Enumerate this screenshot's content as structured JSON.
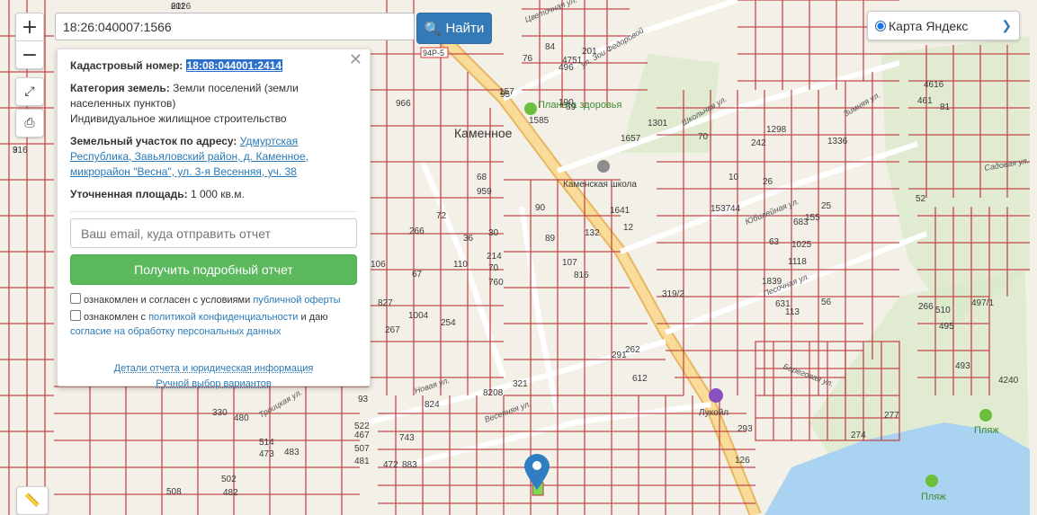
{
  "search": {
    "value": "18:26:040007:1566",
    "button_label": "Найти"
  },
  "controls": {
    "zoom_in": "+",
    "zoom_out": "−"
  },
  "layer": {
    "selected": "Карта Яндекс"
  },
  "popup": {
    "cadastral_label": "Кадастровый номер:",
    "cadastral_value": "18:08:044001:2414",
    "category_label": "Категория земель:",
    "category_value": "Земли поселений (земли населенных пунктов)",
    "category_use": "Индивидуальное жилищное строительство",
    "address_label": "Земельный участок по адресу:",
    "address_value": "Удмуртская Республика, Завьяловский район, д. Каменное, микрорайон \"Весна\", ул. 3-я Весенняя, уч. 38",
    "area_label": "Уточненная площадь:",
    "area_value": "1 000 кв.м.",
    "email_placeholder": "Ваш email, куда отправить отчет",
    "report_button": "Получить подробный отчет",
    "consent1_text": "ознакомлен и согласен с условиями",
    "consent1_link": "публичной оферты",
    "consent2_text": "ознакомлен с",
    "consent2_link": "политикой конфиденциальности",
    "consent2_and": "и даю",
    "consent2_link2": "согласие на обработку персональных данных",
    "details_link": "Детали отчета и юридическая информация",
    "manual_link": "Ручной выбор вариантов"
  },
  "map_labels": {
    "place": "Каменное",
    "school": "Каменская школа",
    "clinic": "Планета здоровья",
    "fuel": "Лукойл",
    "beach1": "Пляж",
    "beach2": "Пляж",
    "road": "94Р-5",
    "street_1": "Цветочная ул.",
    "street_2": "ул. Зои Федоровой",
    "street_3": "Юбилейная ул.",
    "street_4": "Школьная ул.",
    "street_5": "Зимняя ул.",
    "street_6": "Весенняя ул.",
    "street_7": "Новая ул.",
    "street_8": "Троицкая ул.",
    "street_9": "Садовая ул.",
    "street_10": "Береговая ул.",
    "street_11": "Песочная ул.",
    "numbers": [
      "611",
      "916",
      "966",
      "1585",
      "1301",
      "1657",
      "959",
      "68",
      "72",
      "266",
      "36",
      "30",
      "214",
      "110",
      "67",
      "106",
      "70",
      "760",
      "107",
      "816",
      "89",
      "90",
      "254",
      "1004",
      "827",
      "267",
      "93",
      "522",
      "467",
      "507",
      "481",
      "330",
      "480",
      "514",
      "473",
      "502",
      "482",
      "483",
      "508",
      "472",
      "883",
      "743",
      "612",
      "824",
      "8208",
      "321",
      "262",
      "291",
      "277",
      "274",
      "266",
      "510",
      "493",
      "495",
      "497/1",
      "4240",
      "461",
      "4616",
      "126",
      "293",
      "319/2",
      "1839",
      "631",
      "113",
      "56",
      "63",
      "1118",
      "683",
      "25",
      "44",
      "1537",
      "242",
      "26",
      "1298",
      "10",
      "70",
      "1336",
      "81",
      "52",
      "12",
      "1641",
      "496",
      "69",
      "76",
      "84",
      "4751",
      "157",
      "95",
      "190",
      "201",
      "155",
      "1025",
      "132",
      "2026",
      "3"
    ]
  },
  "colors": {
    "parcel": "#c0393b",
    "road_main": "#f6cf7e",
    "water": "#a9d3f0",
    "green": "#d6e8c4",
    "marker": "#2f7ec0",
    "selected_parcel": "#7ed957"
  }
}
